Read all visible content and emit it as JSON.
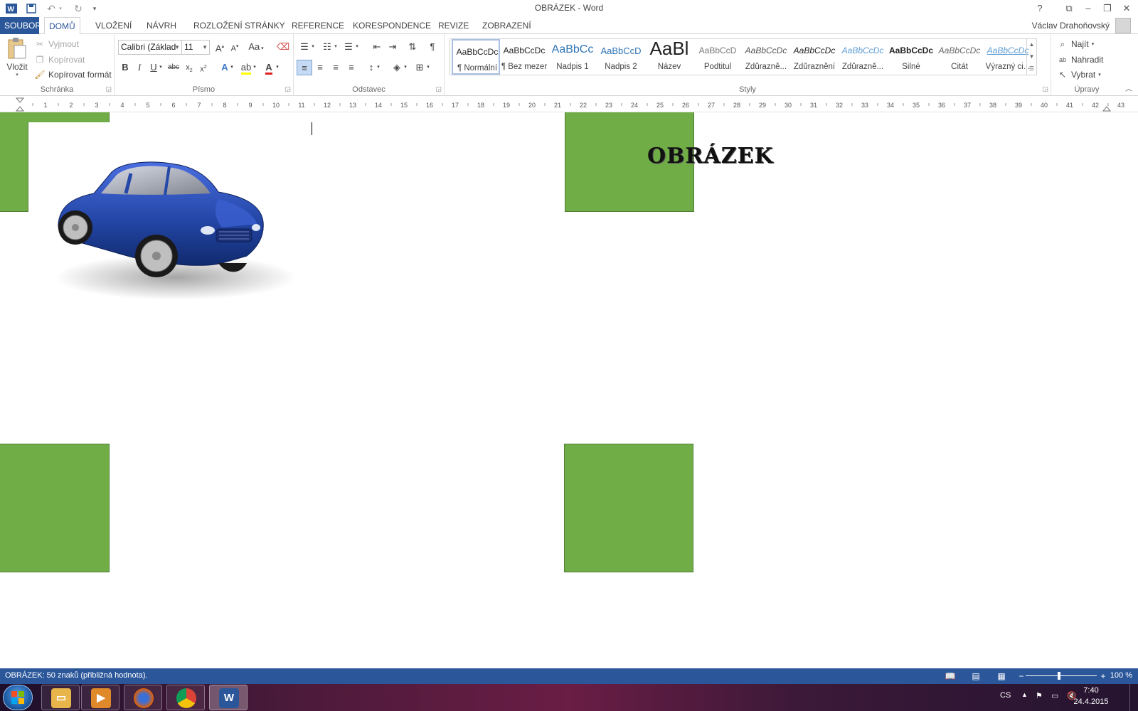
{
  "app": {
    "title": "OBRÁZEK - Word",
    "user": "Václav Drahoňovský"
  },
  "tabs": [
    {
      "label": "SOUBOR"
    },
    {
      "label": "DOMŮ"
    },
    {
      "label": "VLOŽENÍ"
    },
    {
      "label": "NÁVRH"
    },
    {
      "label": "ROZLOŽENÍ STRÁNKY"
    },
    {
      "label": "REFERENCE"
    },
    {
      "label": "KORESPONDENCE"
    },
    {
      "label": "REVIZE"
    },
    {
      "label": "ZOBRAZENÍ"
    }
  ],
  "clipboard": {
    "paste": "Vložit",
    "cut": "Vyjmout",
    "copy": "Kopírovat",
    "format_painter": "Kopírovat formát",
    "label": "Schránka"
  },
  "font": {
    "family": "Calibri (Základ",
    "size": "11",
    "change_case": "Aa",
    "label": "Písmo"
  },
  "paragraph": {
    "label": "Odstavec"
  },
  "styles": {
    "label": "Styly",
    "items": [
      {
        "preview": "AaBbCcDc",
        "name": "¶ Normální"
      },
      {
        "preview": "AaBbCcDc",
        "name": "¶ Bez mezer"
      },
      {
        "preview": "AaBbCc",
        "name": "Nadpis 1"
      },
      {
        "preview": "AaBbCcD",
        "name": "Nadpis 2"
      },
      {
        "preview": "AaBl",
        "name": "Název"
      },
      {
        "preview": "AaBbCcD",
        "name": "Podtitul"
      },
      {
        "preview": "AaBbCcDc",
        "name": "Zdůrazně..."
      },
      {
        "preview": "AaBbCcDc",
        "name": "Zdůraznění"
      },
      {
        "preview": "AaBbCcDc",
        "name": "Zdůrazně..."
      },
      {
        "preview": "AaBbCcDc",
        "name": "Silné"
      },
      {
        "preview": "AaBbCcDc",
        "name": "Citát"
      },
      {
        "preview": "AaBbCcDc",
        "name": "Výrazný ci..."
      }
    ]
  },
  "editing": {
    "find": "Najít",
    "replace": "Nahradit",
    "select": "Vybrat",
    "label": "Úpravy"
  },
  "ruler": {
    "ticks": [
      "1",
      "2",
      "3",
      "4",
      "5",
      "6",
      "7",
      "8",
      "9",
      "10",
      "11",
      "12",
      "13",
      "14",
      "15",
      "16",
      "17",
      "18",
      "19",
      "20",
      "21",
      "22",
      "23",
      "24",
      "25",
      "26",
      "27",
      "28",
      "29",
      "30",
      "31",
      "32",
      "33",
      "34",
      "35",
      "36",
      "37",
      "38",
      "39",
      "40",
      "41",
      "42",
      "43"
    ]
  },
  "document": {
    "heading": "OBRÁZEK"
  },
  "status": {
    "text": "OBRÁZEK: 50 znaků (přibližná hodnota).",
    "zoom": "100 %"
  },
  "taskbar": {
    "language": "CS",
    "time": "7:40",
    "date": "24.4.2015"
  },
  "colors": {
    "accent": "#2b579a",
    "shape_fill": "#70ad47",
    "car": "#2447a8"
  }
}
